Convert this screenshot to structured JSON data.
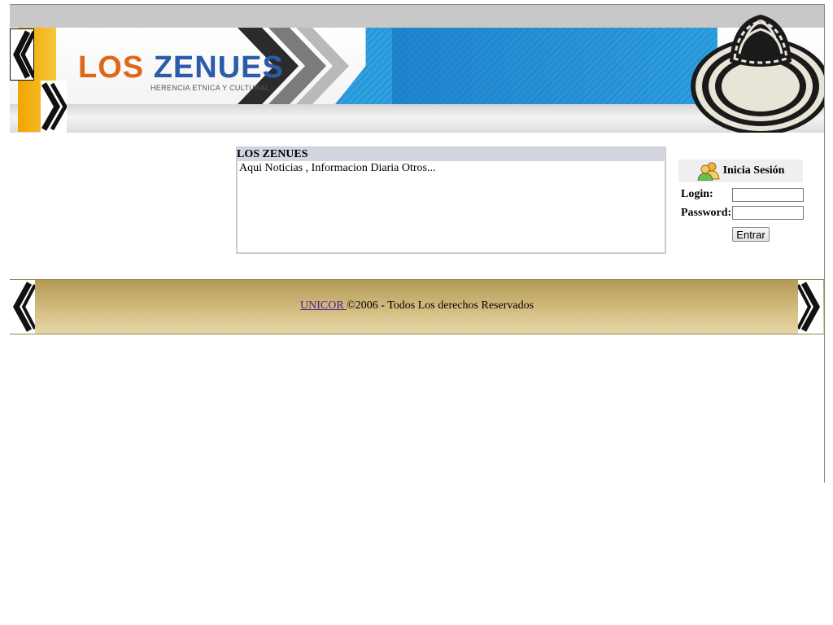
{
  "header": {
    "logo_word1": "LOS",
    "logo_word2": "ZENUES",
    "logo_subtitle": "HERENCIA ETNICA Y CULTURAL"
  },
  "news": {
    "title": "LOS ZENUES",
    "body": "Aqui Noticias , Informacion Diaria Otros..."
  },
  "login": {
    "heading": "Inicia Sesión",
    "login_label": "Login:",
    "password_label": "Password:",
    "login_value": "",
    "password_value": "",
    "submit_label": "Entrar",
    "icon": "users-icon"
  },
  "footer": {
    "link_text": "UNICOR ",
    "copyright_text": "©2006 - Todos Los derechos Reservados"
  },
  "colors": {
    "logo_orange": "#e0661a",
    "logo_blue": "#2a5caa",
    "banner_blue": "#2fa2e2",
    "footer_gold": "#c7ae6a",
    "news_header": "#d3d6e0"
  }
}
